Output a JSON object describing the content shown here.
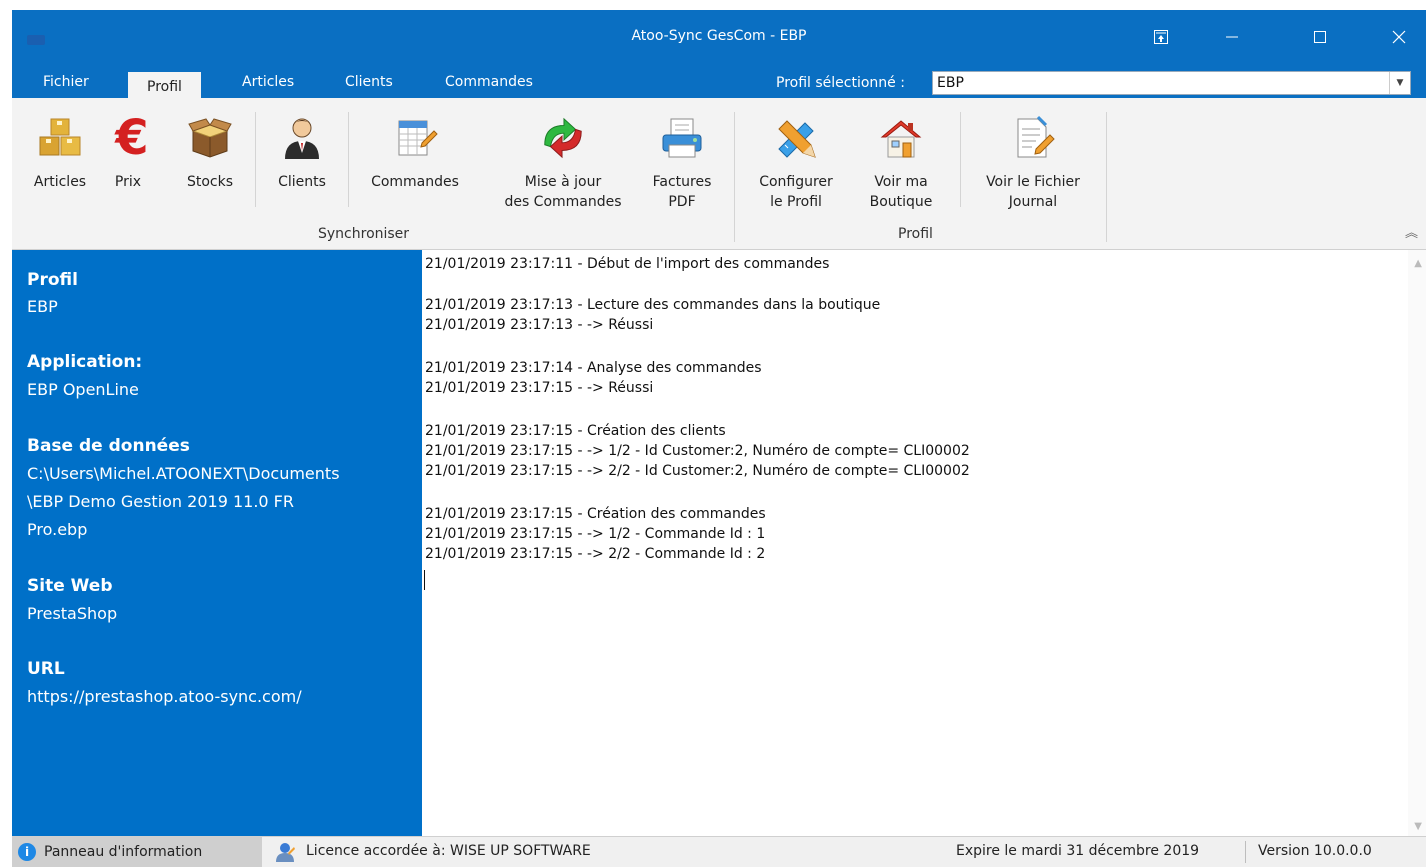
{
  "window": {
    "title": "Atoo-Sync GesCom - EBP",
    "controls": [
      "pin-icon",
      "minimize-icon",
      "maximize-icon",
      "close-icon"
    ]
  },
  "menu_tabs": [
    {
      "label": "Fichier"
    },
    {
      "label": "Profil"
    },
    {
      "label": "Articles"
    },
    {
      "label": "Clients"
    },
    {
      "label": "Commandes"
    }
  ],
  "active_tab": "Profil",
  "profile_selector": {
    "label": "Profil sélectionné :",
    "value": "EBP"
  },
  "ribbon": {
    "buttons": [
      {
        "label": "Articles",
        "icon": "boxes-icon"
      },
      {
        "label": "Prix",
        "icon": "euro-icon"
      },
      {
        "label": "Stocks",
        "icon": "box-open-icon"
      },
      {
        "label": "Clients",
        "icon": "user-icon"
      },
      {
        "label": "Commandes",
        "icon": "order-sheet-icon"
      },
      {
        "label": "Mise à jour\ndes Commandes",
        "icon": "sync-arrows-icon"
      },
      {
        "label": "Factures\nPDF",
        "icon": "printer-icon"
      },
      {
        "label": "Configurer\nle Profil",
        "icon": "pencil-ruler-icon"
      },
      {
        "label": "Voir ma\nBoutique",
        "icon": "house-icon"
      },
      {
        "label": "Voir le Fichier\nJournal",
        "icon": "document-edit-icon"
      }
    ],
    "groups": [
      "Synchroniser",
      "Profil"
    ]
  },
  "info_panel": {
    "profil_heading": "Profil",
    "profil_value": "EBP",
    "application_heading": "Application:",
    "application_value": "EBP OpenLine",
    "db_heading": "Base de données",
    "db_value_1": "C:\\Users\\Michel.ATOONEXT\\Documents",
    "db_value_2": "\\EBP Demo Gestion 2019 11.0 FR",
    "db_value_3": "Pro.ebp",
    "site_heading": "Site Web",
    "site_value": "PrestaShop",
    "url_heading": "URL",
    "url_value": "https://prestashop.atoo-sync.com/"
  },
  "log_lines": [
    "21/01/2019 23:17:11 - Début de l'import des commandes",
    "21/01/2019 23:17:13 - Lecture des commandes dans la boutique",
    "21/01/2019 23:17:13 - -> Réussi",
    "21/01/2019 23:17:14 - Analyse des commandes",
    "21/01/2019 23:17:15 - -> Réussi",
    "21/01/2019 23:17:15 - Création des clients",
    "21/01/2019 23:17:15 - -> 1/2 - Id Customer:2, Numéro de compte= CLI00002",
    "21/01/2019 23:17:15 - -> 2/2 - Id Customer:2, Numéro de compte= CLI00002",
    "21/01/2019 23:17:15 - Création des commandes",
    "21/01/2019 23:17:15 - -> 1/2 - Commande Id : 1",
    "21/01/2019 23:17:15 - -> 2/2 - Commande Id : 2"
  ],
  "status": {
    "panel_label": "Panneau d'information",
    "licence": "Licence accordée à: WISE UP SOFTWARE",
    "expiry": "Expire le mardi 31 décembre 2019",
    "version": "Version 10.0.0.0"
  },
  "colors": {
    "accent": "#0a6fc2",
    "sidebar": "#0070c8",
    "ribbon": "#f3f3f3"
  }
}
